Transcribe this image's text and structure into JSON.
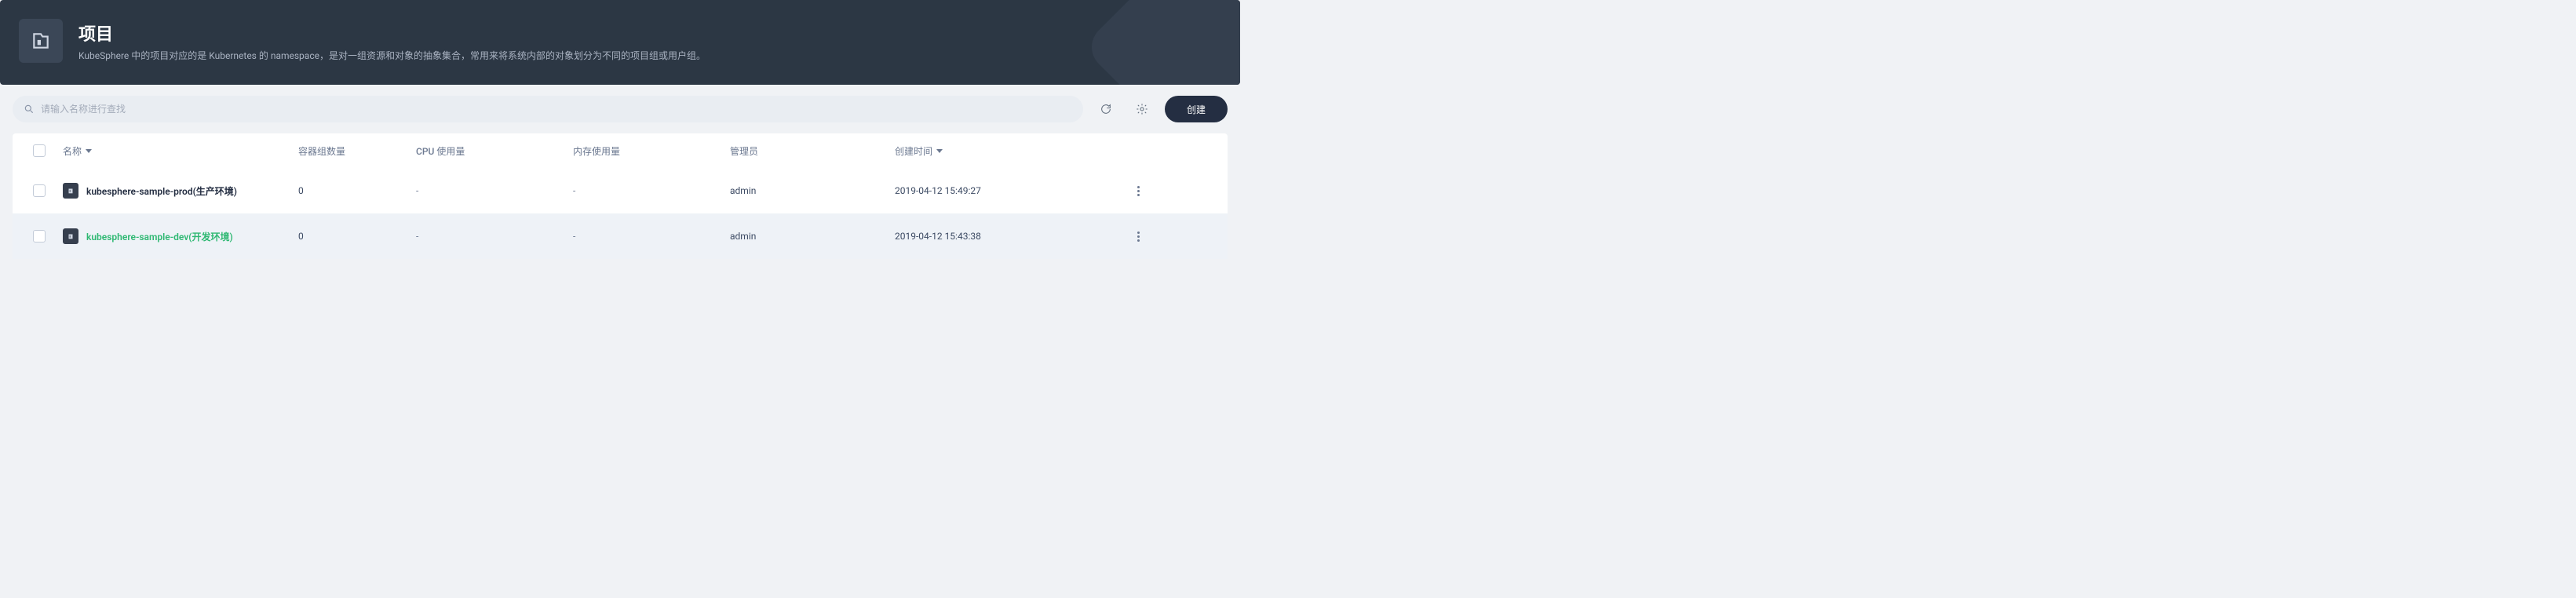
{
  "header": {
    "title": "项目",
    "description": "KubeSphere 中的项目对应的是 Kubernetes 的 namespace，是对一组资源和对象的抽象集合，常用来将系统内部的对象划分为不同的项目组或用户组。"
  },
  "toolbar": {
    "search_placeholder": "请输入名称进行查找",
    "create_label": "创建"
  },
  "table": {
    "columns": {
      "name": "名称",
      "pod_count": "容器组数量",
      "cpu_usage": "CPU 使用量",
      "memory_usage": "内存使用量",
      "admin": "管理员",
      "created_at": "创建时间"
    },
    "rows": [
      {
        "name": "kubesphere-sample-prod(生产环境)",
        "pod_count": "0",
        "cpu_usage": "-",
        "memory_usage": "-",
        "admin": "admin",
        "created_at": "2019-04-12 15:49:27",
        "hovered": false
      },
      {
        "name": "kubesphere-sample-dev(开发环境)",
        "pod_count": "0",
        "cpu_usage": "-",
        "memory_usage": "-",
        "admin": "admin",
        "created_at": "2019-04-12 15:43:38",
        "hovered": true
      }
    ]
  }
}
